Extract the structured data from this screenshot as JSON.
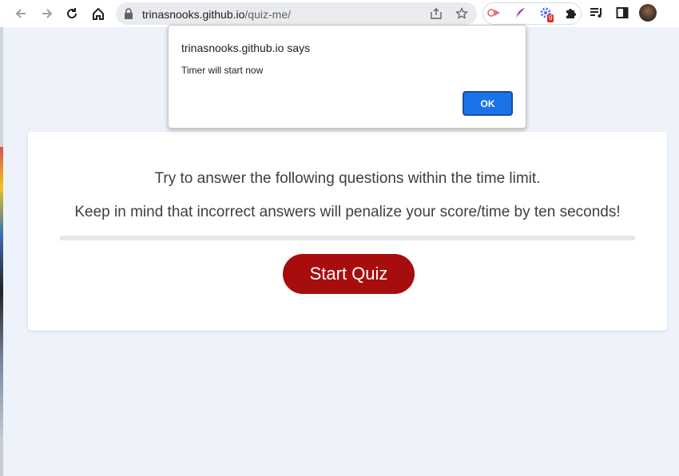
{
  "browser": {
    "url_host": "trinasnooks.github.io",
    "url_path": "/quiz-me/",
    "extension_badge": "9"
  },
  "dialog": {
    "title": "trinasnooks.github.io says",
    "message": "Timer will start now",
    "ok_label": "OK"
  },
  "quiz": {
    "instruction_1": "Try to answer the following questions within the time limit.",
    "instruction_2": "Keep in mind that incorrect answers will penalize your score/time by ten seconds!",
    "start_label": "Start Quiz"
  },
  "colors": {
    "page_background": "#eef3fb",
    "start_button": "#a70d0d",
    "ok_button": "#1a73e8"
  },
  "icons": [
    "back-arrow-icon",
    "forward-arrow-icon",
    "reload-icon",
    "home-icon",
    "lock-icon",
    "share-icon",
    "star-icon",
    "cast-icon",
    "feather-icon",
    "gear-icon",
    "puzzle-icon",
    "playlist-icon",
    "sidebar-icon"
  ]
}
